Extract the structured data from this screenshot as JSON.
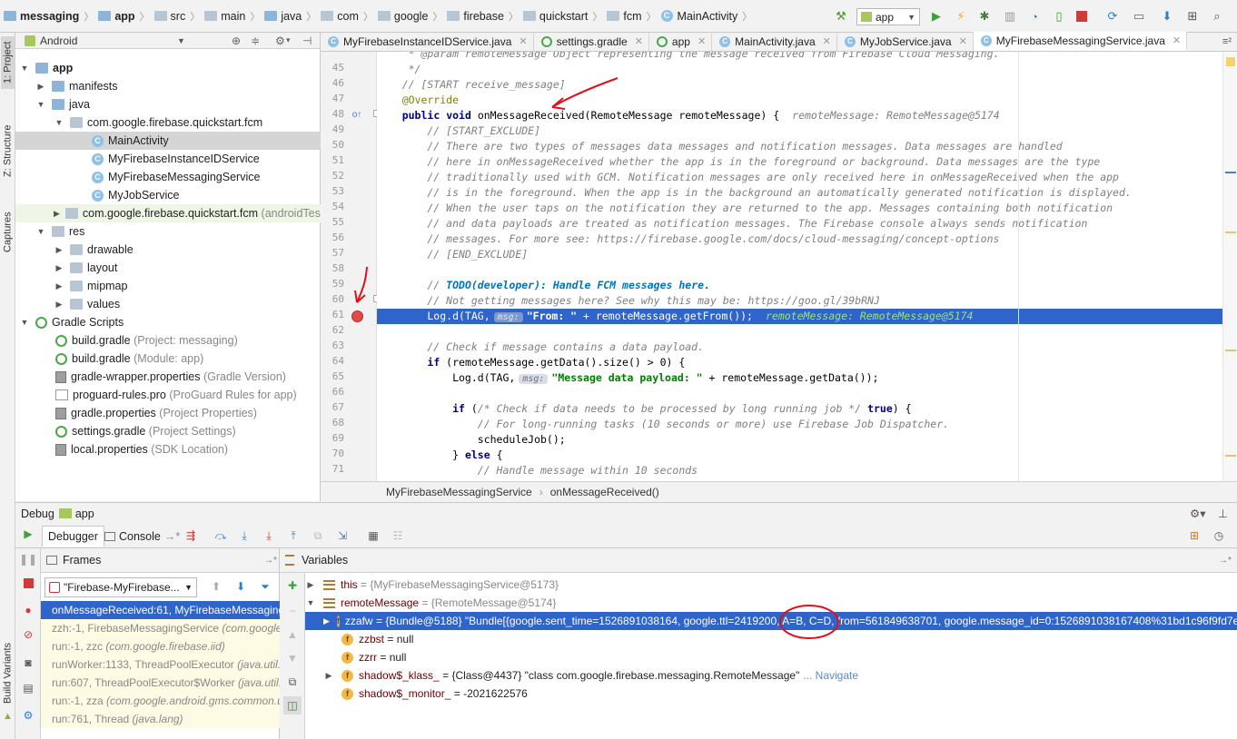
{
  "navbar": {
    "crumbs": [
      "messaging",
      "app",
      "src",
      "main",
      "java",
      "com",
      "google",
      "firebase",
      "quickstart",
      "fcm",
      "MainActivity"
    ],
    "run_config": "app"
  },
  "left_stripe": {
    "project": "1: Project",
    "structure": "Z: Structure",
    "captures": "Captures",
    "build_variants": "Build Variants"
  },
  "project": {
    "view": "Android",
    "tree": [
      {
        "label": "app",
        "extra": ""
      },
      {
        "label": "manifests",
        "extra": ""
      },
      {
        "label": "java",
        "extra": ""
      },
      {
        "label": "com.google.firebase.quickstart.fcm",
        "extra": ""
      },
      {
        "label": "MainActivity",
        "extra": ""
      },
      {
        "label": "MyFirebaseInstanceIDService",
        "extra": ""
      },
      {
        "label": "MyFirebaseMessagingService",
        "extra": ""
      },
      {
        "label": "MyJobService",
        "extra": ""
      },
      {
        "label": "com.google.firebase.quickstart.fcm",
        "extra": "(androidTest)"
      },
      {
        "label": "res",
        "extra": ""
      },
      {
        "label": "drawable",
        "extra": ""
      },
      {
        "label": "layout",
        "extra": ""
      },
      {
        "label": "mipmap",
        "extra": ""
      },
      {
        "label": "values",
        "extra": ""
      },
      {
        "label": "Gradle Scripts",
        "extra": ""
      },
      {
        "label": "build.gradle",
        "extra": "(Project: messaging)"
      },
      {
        "label": "build.gradle",
        "extra": "(Module: app)"
      },
      {
        "label": "gradle-wrapper.properties",
        "extra": "(Gradle Version)"
      },
      {
        "label": "proguard-rules.pro",
        "extra": "(ProGuard Rules for app)"
      },
      {
        "label": "gradle.properties",
        "extra": "(Project Properties)"
      },
      {
        "label": "settings.gradle",
        "extra": "(Project Settings)"
      },
      {
        "label": "local.properties",
        "extra": "(SDK Location)"
      }
    ]
  },
  "editor": {
    "tabs": [
      "MyFirebaseInstanceIDService.java",
      "settings.gradle",
      "app",
      "MainActivity.java",
      "MyJobService.java",
      "MyFirebaseMessagingService.java"
    ],
    "active_tab": 5,
    "line_numbers": [
      "45",
      "46",
      "47",
      "48",
      "49",
      "50",
      "51",
      "52",
      "53",
      "54",
      "55",
      "56",
      "57",
      "58",
      "59",
      "60",
      "61",
      "62",
      "63",
      "64",
      "65",
      "66",
      "67",
      "68",
      "69",
      "70",
      "71"
    ],
    "lines": {
      "l44": "     * @param remoteMessage Object representing the message received from Firebase Cloud Messaging.",
      "l45": "     */",
      "l46": "    // [START receive_message]",
      "l47": "    @Override",
      "l48_a": "public",
      "l48_b": "void",
      "l48_c": " onMessageReceived(RemoteMessage remoteMessage) {",
      "l48_hint": "remoteMessage: RemoteMessage@5174",
      "l49": "        // [START_EXCLUDE]",
      "l50": "        // There are two types of messages data messages and notification messages. Data messages are handled",
      "l51": "        // here in onMessageReceived whether the app is in the foreground or background. Data messages are the type",
      "l52": "        // traditionally used with GCM. Notification messages are only received here in onMessageReceived when the app",
      "l53": "        // is in the foreground. When the app is in the background an automatically generated notification is displayed.",
      "l54": "        // When the user taps on the notification they are returned to the app. Messages containing both notification",
      "l55": "        // and data payloads are treated as notification messages. The Firebase console always sends notification",
      "l56": "        // messages. For more see: https://firebase.google.com/docs/cloud-messaging/concept-options",
      "l57": "        // [END_EXCLUDE]",
      "l59_a": "        // ",
      "l59_b": "TODO(developer): Handle FCM messages here.",
      "l60": "        // Not getting messages here? See why this may be: https://goo.gl/39bRNJ",
      "l61_a": "        Log.d(TAG,",
      "l61_pill": "msg:",
      "l61_b": "\"From: \"",
      "l61_c": " + remoteMessage.getFrom());",
      "l61_hint": "remoteMessage: RemoteMessage@5174",
      "l63": "        // Check if message contains a data payload.",
      "l64_a": "if",
      "l64_b": " (remoteMessage.getData().size() > 0) {",
      "l65_a": "            Log.d(TAG,",
      "l65_pill": "msg:",
      "l65_b": "\"Message data payload: \"",
      "l65_c": " + remoteMessage.getData());",
      "l67_a": "if",
      "l67_b": " (",
      "l67_c": "/* Check if data needs to be processed by long running job */",
      "l67_d": " true",
      "l67_e": ") {",
      "l68": "                // For long-running tasks (10 seconds or more) use Firebase Job Dispatcher.",
      "l69": "                scheduleJob();",
      "l70_a": "            } ",
      "l70_b": "else",
      "l70_c": " {",
      "l71": "                // Handle message within 10 seconds"
    },
    "breadcrumb": [
      "MyFirebaseMessagingService",
      "onMessageReceived()"
    ]
  },
  "debug": {
    "title": "Debug",
    "config": "app",
    "tabs": {
      "debugger": "Debugger",
      "console": "Console"
    },
    "frames_title": "Frames",
    "thread": "\"Firebase-MyFirebase...",
    "frames": [
      {
        "name": "onMessageReceived:61, MyFirebaseMessagingS",
        "pkg": ""
      },
      {
        "name": "zzh:-1, FirebaseMessagingService",
        "pkg": "(com.google.fi"
      },
      {
        "name": "run:-1, zzc",
        "pkg": "(com.google.firebase.iid)"
      },
      {
        "name": "runWorker:1133, ThreadPoolExecutor",
        "pkg": "(java.util.c"
      },
      {
        "name": "run:607, ThreadPoolExecutor$Worker",
        "pkg": "(java.util.c"
      },
      {
        "name": "run:-1, zza",
        "pkg": "(com.google.android.gms.common.ut"
      },
      {
        "name": "run:761, Thread",
        "pkg": "(java.lang)"
      }
    ],
    "variables_title": "Variables",
    "variables": [
      {
        "name": "this",
        "value": "{MyFirebaseMessagingService@5173}"
      },
      {
        "name": "remoteMessage",
        "value": "{RemoteMessage@5174}"
      },
      {
        "name": "zzafw",
        "value": "{Bundle@5188} \"Bundle[{google.sent_time=1526891038164, google.ttl=2419200, A=B, C=D, from=561849638701, google.message_id=0:1526891038167408%31bd1c96f9fd7ecd}]\""
      },
      {
        "name": "zzbst",
        "value": "null"
      },
      {
        "name": "zzrr",
        "value": "null"
      },
      {
        "name": "shadow$_klass_",
        "value": "{Class@4437} \"class com.google.firebase.messaging.RemoteMessage\"",
        "link": "... Navigate"
      },
      {
        "name": "shadow$_monitor_",
        "value": "-2021622576"
      }
    ]
  },
  "colors": {
    "selection": "#2f65ca",
    "annotation": "#e0101a"
  }
}
